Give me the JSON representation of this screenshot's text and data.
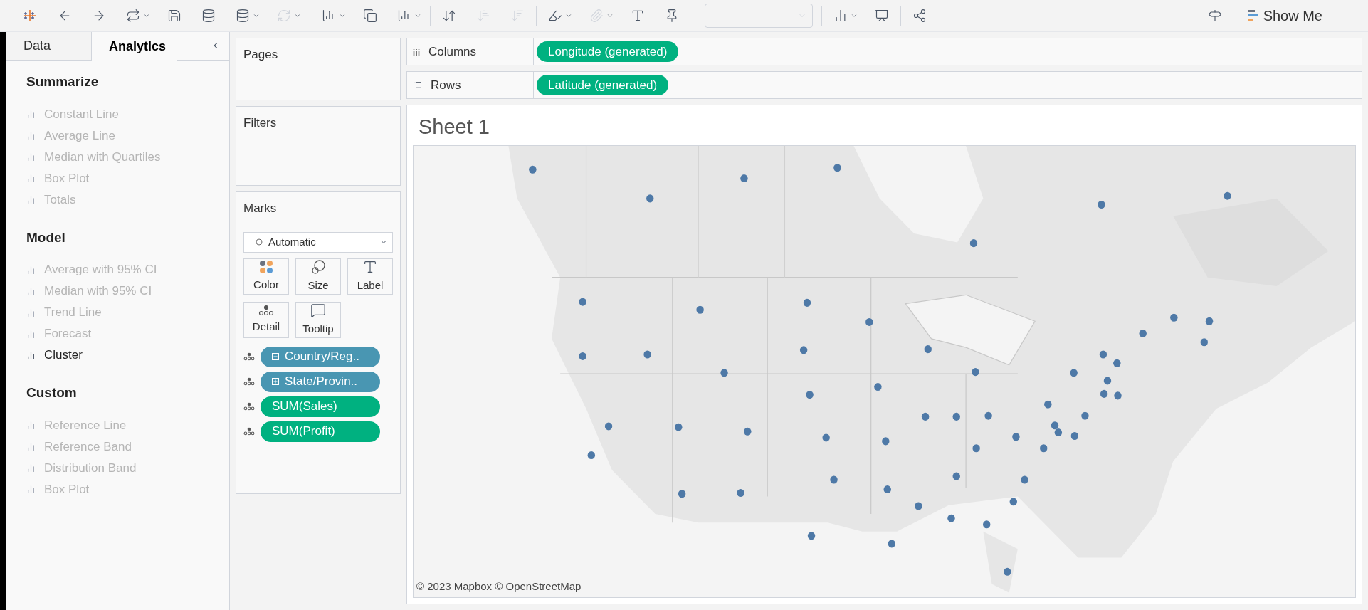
{
  "side_tabs": [
    {
      "label": "Data",
      "selected": false
    },
    {
      "label": "Analytics",
      "selected": true
    }
  ],
  "analytics": [
    {
      "heading": "Summarize",
      "items": [
        {
          "label": "Constant Line",
          "disabled": true
        },
        {
          "label": "Average Line",
          "disabled": true
        },
        {
          "label": "Median with Quartiles",
          "disabled": true
        },
        {
          "label": "Box Plot",
          "disabled": true
        },
        {
          "label": "Totals",
          "disabled": true
        }
      ]
    },
    {
      "heading": "Model",
      "items": [
        {
          "label": "Average with 95% CI",
          "disabled": true
        },
        {
          "label": "Median with 95% CI",
          "disabled": true
        },
        {
          "label": "Trend Line",
          "disabled": true
        },
        {
          "label": "Forecast",
          "disabled": true
        },
        {
          "label": "Cluster",
          "disabled": false
        }
      ]
    },
    {
      "heading": "Custom",
      "items": [
        {
          "label": "Reference Line",
          "disabled": true
        },
        {
          "label": "Reference Band",
          "disabled": true
        },
        {
          "label": "Distribution Band",
          "disabled": true
        },
        {
          "label": "Box Plot",
          "disabled": true
        }
      ]
    }
  ],
  "pages": {
    "title": "Pages"
  },
  "filters": {
    "title": "Filters"
  },
  "marks": {
    "title": "Marks",
    "mark_type": "Automatic",
    "cards": [
      {
        "kind": "color",
        "label": "Color"
      },
      {
        "kind": "size",
        "label": "Size"
      },
      {
        "kind": "label",
        "label": "Label"
      },
      {
        "kind": "detail",
        "label": "Detail"
      },
      {
        "kind": "tooltip",
        "label": "Tooltip"
      }
    ],
    "pills": [
      {
        "kind": "dimension",
        "label": "Country/Reg..",
        "expanded": true
      },
      {
        "kind": "dimension",
        "label": "State/Provin..",
        "expanded": false
      },
      {
        "kind": "measure",
        "label": "SUM(Sales)"
      },
      {
        "kind": "measure",
        "label": "SUM(Profit)"
      }
    ]
  },
  "shelves": [
    {
      "kind": "columns",
      "label": "Columns",
      "pill": "Longitude (generated)"
    },
    {
      "kind": "rows",
      "label": "Rows",
      "pill": "Latitude (generated)"
    }
  ],
  "sheet": {
    "title": "Sheet 1",
    "attribution": "© 2023 Mapbox © OpenStreetMap"
  },
  "toolbar": {
    "show_me": "Show Me"
  }
}
